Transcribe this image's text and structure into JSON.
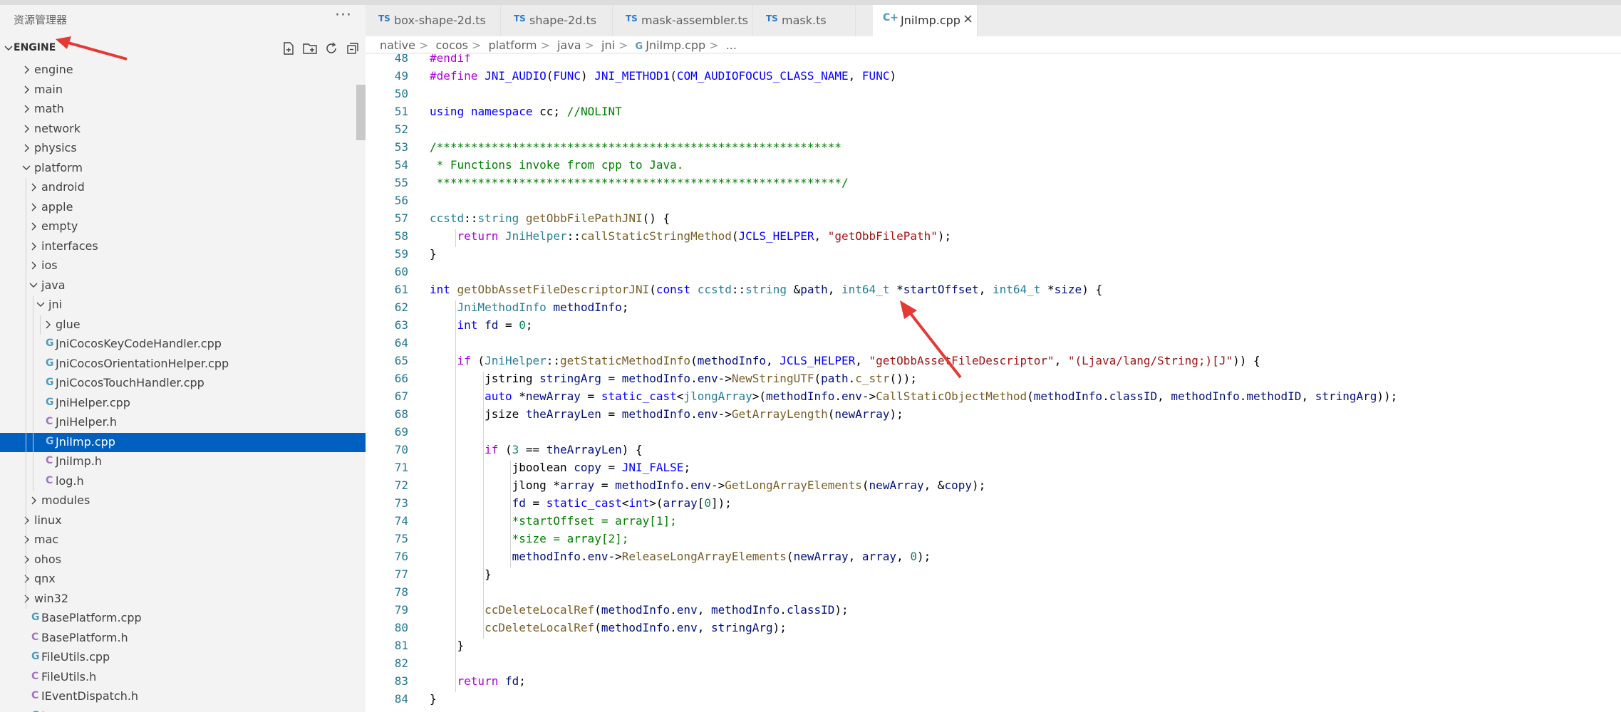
{
  "sidebar": {
    "title": "资源管理器",
    "more_label": "···",
    "section": "ENGINE",
    "actions": [
      "new-file-icon",
      "new-folder-icon",
      "refresh-icon",
      "collapse-all-icon"
    ],
    "tree": [
      {
        "label": "engine",
        "kind": "folder",
        "expanded": false
      },
      {
        "label": "main",
        "kind": "folder",
        "expanded": false
      },
      {
        "label": "math",
        "kind": "folder",
        "expanded": false
      },
      {
        "label": "network",
        "kind": "folder",
        "expanded": false
      },
      {
        "label": "physics",
        "kind": "folder",
        "expanded": false
      },
      {
        "label": "platform",
        "kind": "folder",
        "expanded": true
      },
      {
        "label": "android",
        "kind": "folder",
        "expanded": false
      },
      {
        "label": "apple",
        "kind": "folder",
        "expanded": false
      },
      {
        "label": "empty",
        "kind": "folder",
        "expanded": false
      },
      {
        "label": "interfaces",
        "kind": "folder",
        "expanded": false
      },
      {
        "label": "ios",
        "kind": "folder",
        "expanded": false
      },
      {
        "label": "java",
        "kind": "folder",
        "expanded": true
      },
      {
        "label": "jni",
        "kind": "folder",
        "expanded": true
      },
      {
        "label": "glue",
        "kind": "folder",
        "expanded": false
      },
      {
        "label": "JniCocosKeyCodeHandler.cpp",
        "kind": "cpp"
      },
      {
        "label": "JniCocosOrientationHelper.cpp",
        "kind": "cpp"
      },
      {
        "label": "JniCocosTouchHandler.cpp",
        "kind": "cpp"
      },
      {
        "label": "JniHelper.cpp",
        "kind": "cpp"
      },
      {
        "label": "JniHelper.h",
        "kind": "h"
      },
      {
        "label": "JniImp.cpp",
        "kind": "cpp",
        "selected": true
      },
      {
        "label": "JniImp.h",
        "kind": "h"
      },
      {
        "label": "log.h",
        "kind": "h"
      },
      {
        "label": "modules",
        "kind": "folder",
        "expanded": false
      },
      {
        "label": "linux",
        "kind": "folder",
        "expanded": false
      },
      {
        "label": "mac",
        "kind": "folder",
        "expanded": false
      },
      {
        "label": "ohos",
        "kind": "folder",
        "expanded": false
      },
      {
        "label": "qnx",
        "kind": "folder",
        "expanded": false
      },
      {
        "label": "win32",
        "kind": "folder",
        "expanded": false
      },
      {
        "label": "BasePlatform.cpp",
        "kind": "cpp"
      },
      {
        "label": "BasePlatform.h",
        "kind": "h"
      },
      {
        "label": "FileUtils.cpp",
        "kind": "cpp"
      },
      {
        "label": "FileUtils.h",
        "kind": "h"
      },
      {
        "label": "IEventDispatch.h",
        "kind": "h"
      },
      {
        "label": "Image.cpp",
        "kind": "cpp"
      }
    ]
  },
  "tabs": [
    {
      "label": "box-shape-2d.ts",
      "badge": "TS"
    },
    {
      "label": "shape-2d.ts",
      "badge": "TS"
    },
    {
      "label": "mask-assembler.ts",
      "badge": "TS"
    },
    {
      "label": "mask.ts",
      "badge": "TS"
    },
    {
      "label": "JniImp.cpp",
      "badge": "C+",
      "active": true,
      "close": "×"
    }
  ],
  "breadcrumb": [
    "native",
    "cocos",
    "platform",
    "java",
    "jni",
    "JniImp.cpp",
    "..."
  ],
  "breadcrumb_sep": ">",
  "breadcrumb_icon": "G",
  "code": [
    {
      "n": "48",
      "t": "#endif"
    },
    {
      "n": "49",
      "t": "#define JNI_AUDIO(FUNC) JNI_METHOD1(COM_AUDIOFOCUS_CLASS_NAME, FUNC)"
    },
    {
      "n": "50",
      "t": ""
    },
    {
      "n": "51",
      "t": "using namespace cc; //NOLINT"
    },
    {
      "n": "52",
      "t": ""
    },
    {
      "n": "53",
      "t": "/***********************************************************"
    },
    {
      "n": "54",
      "t": " * Functions invoke from cpp to Java."
    },
    {
      "n": "55",
      "t": " ***********************************************************/"
    },
    {
      "n": "56",
      "t": ""
    },
    {
      "n": "57",
      "t": "ccstd::string getObbFilePathJNI() {"
    },
    {
      "n": "58",
      "t": "    return JniHelper::callStaticStringMethod(JCLS_HELPER, \"getObbFilePath\");"
    },
    {
      "n": "59",
      "t": "}"
    },
    {
      "n": "60",
      "t": ""
    },
    {
      "n": "61",
      "t": "int getObbAssetFileDescriptorJNI(const ccstd::string &path, int64_t *startOffset, int64_t *size) {"
    },
    {
      "n": "62",
      "t": "    JniMethodInfo methodInfo;"
    },
    {
      "n": "63",
      "t": "    int fd = 0;"
    },
    {
      "n": "64",
      "t": ""
    },
    {
      "n": "65",
      "t": "    if (JniHelper::getStaticMethodInfo(methodInfo, JCLS_HELPER, \"getObbAssetFileDescriptor\", \"(Ljava/lang/String;)[J\")) {"
    },
    {
      "n": "66",
      "t": "        jstring stringArg = methodInfo.env->NewStringUTF(path.c_str());"
    },
    {
      "n": "67",
      "t": "        auto *newArray = static_cast<jlongArray>(methodInfo.env->CallStaticObjectMethod(methodInfo.classID, methodInfo.methodID, stringArg));"
    },
    {
      "n": "68",
      "t": "        jsize theArrayLen = methodInfo.env->GetArrayLength(newArray);"
    },
    {
      "n": "69",
      "t": ""
    },
    {
      "n": "70",
      "t": "        if (3 == theArrayLen) {"
    },
    {
      "n": "71",
      "t": "            jboolean copy = JNI_FALSE;"
    },
    {
      "n": "72",
      "t": "            jlong *array = methodInfo.env->GetLongArrayElements(newArray, &copy);"
    },
    {
      "n": "73",
      "t": "            fd = static_cast<int>(array[0]);"
    },
    {
      "n": "74",
      "t": "            *startOffset = array[1];"
    },
    {
      "n": "75",
      "t": "            *size = array[2];"
    },
    {
      "n": "76",
      "t": "            methodInfo.env->ReleaseLongArrayElements(newArray, array, 0);"
    },
    {
      "n": "77",
      "t": "        }"
    },
    {
      "n": "78",
      "t": ""
    },
    {
      "n": "79",
      "t": "        ccDeleteLocalRef(methodInfo.env, methodInfo.classID);"
    },
    {
      "n": "80",
      "t": "        ccDeleteLocalRef(methodInfo.env, stringArg);"
    },
    {
      "n": "81",
      "t": "    }"
    },
    {
      "n": "82",
      "t": ""
    },
    {
      "n": "83",
      "t": "    return fd;"
    },
    {
      "n": "84",
      "t": "}"
    }
  ],
  "colors": {
    "selection": "#0060c0",
    "annotation_arrow": "#e53935",
    "line_number": "#237893"
  }
}
